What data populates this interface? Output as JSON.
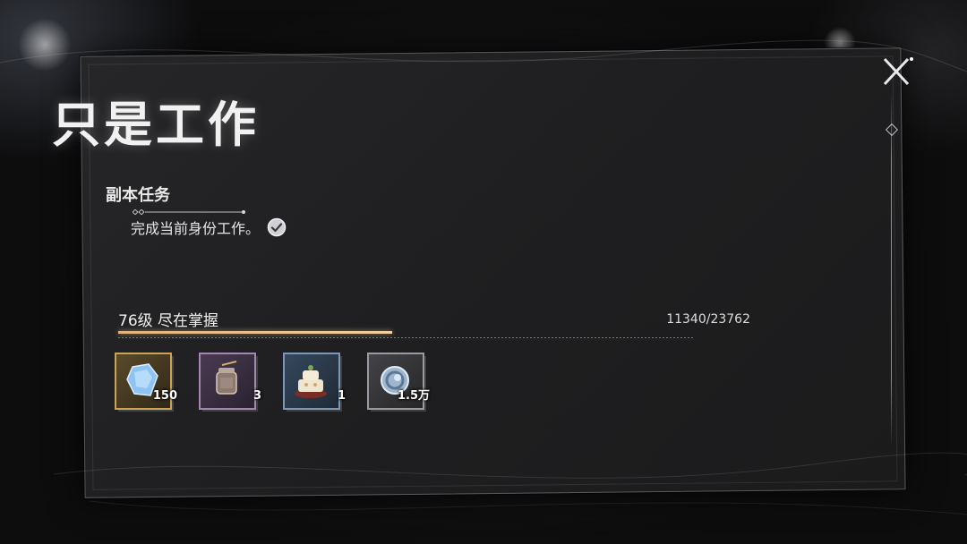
{
  "dialog": {
    "title": "只是工作",
    "close_icon": "close-x-icon"
  },
  "quest": {
    "section_title": "副本任务",
    "task_text": "完成当前身份工作。",
    "task_status": "completed",
    "status_icon": "check-circle-icon"
  },
  "level": {
    "label": "76级  尽在掌握",
    "exp_text": "11340/23762",
    "progress_fraction": 0.477,
    "progress_color": "#f3cf9d"
  },
  "rewards": [
    {
      "name": "blue-crystal-icon",
      "count": "150",
      "rarity_color": "#c9a55a"
    },
    {
      "name": "jar-icon",
      "count": "3",
      "rarity_color": "#a387b3"
    },
    {
      "name": "cake-icon",
      "count": "1",
      "rarity_color": "#7d98b5"
    },
    {
      "name": "silver-coin-icon",
      "count": "1.5万",
      "rarity_color": "#9a9aa0"
    }
  ]
}
